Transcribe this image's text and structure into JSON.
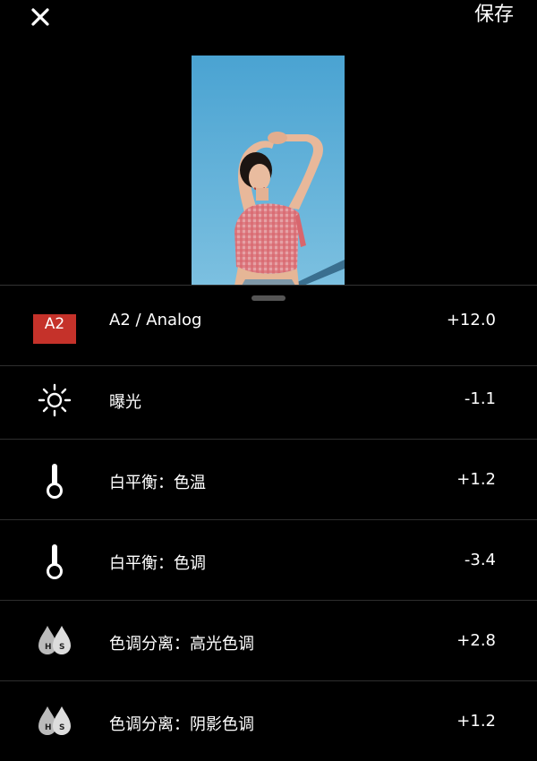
{
  "header": {
    "close_icon": "close-icon",
    "save_label": "保存"
  },
  "preview": {
    "image": "portrait-photo"
  },
  "adjustments": [
    {
      "icon": "a2-badge",
      "badge_text": "A2",
      "label": "A2 / Analog",
      "value": "+12.0"
    },
    {
      "icon": "sun-icon",
      "label": "曝光",
      "value": "-1.1"
    },
    {
      "icon": "thermometer-icon",
      "label": "白平衡：色温",
      "value": "+1.2"
    },
    {
      "icon": "thermometer-icon",
      "label": "白平衡：色调",
      "value": "-3.4"
    },
    {
      "icon": "hs-drops-icon",
      "label": "色调分离：高光色调",
      "value": "+2.8"
    },
    {
      "icon": "hs-drops-icon",
      "label": "色调分离：阴影色调",
      "value": "+1.2"
    }
  ],
  "colors": {
    "background": "#000000",
    "badge": "#c5322a",
    "divider": "#2e2e2e",
    "handle": "#555555"
  }
}
